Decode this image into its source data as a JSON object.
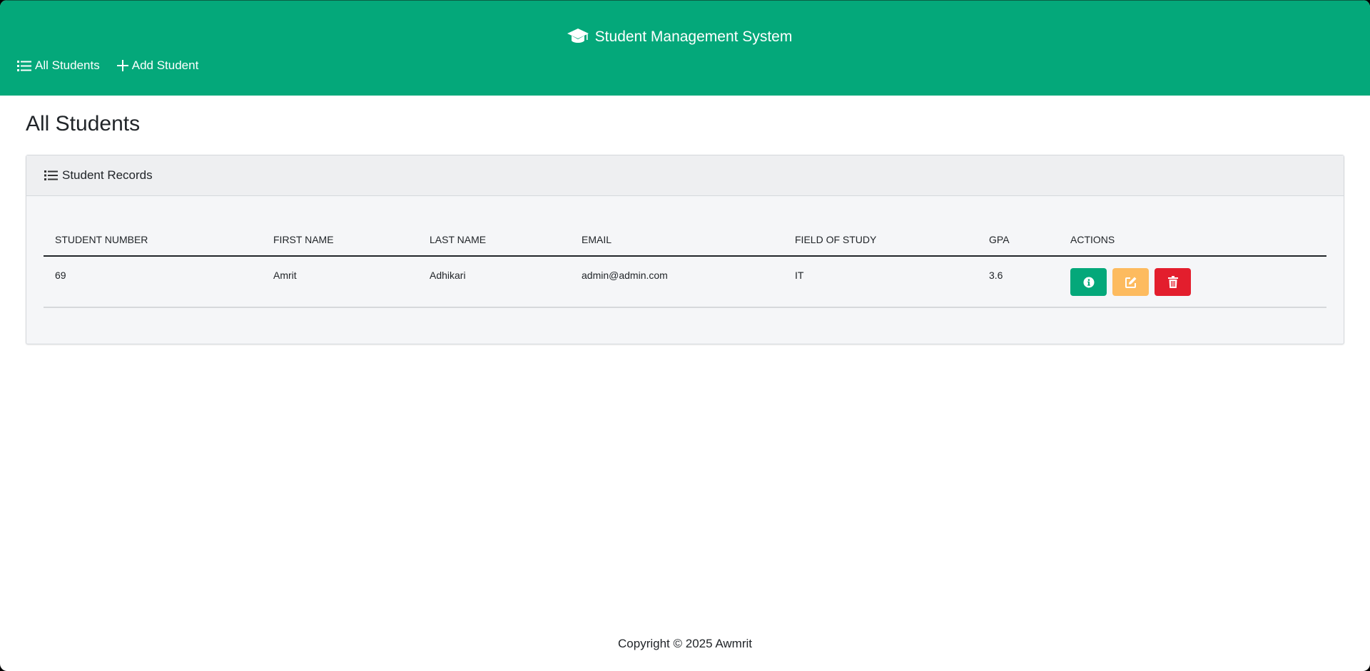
{
  "header": {
    "title": "Student Management System",
    "logo_icon": "graduation-cap-icon",
    "background": "#04a87a"
  },
  "nav": {
    "items": [
      {
        "label": "All Students",
        "icon": "list-icon"
      },
      {
        "label": "Add Student",
        "icon": "plus-icon"
      }
    ]
  },
  "main": {
    "title": "All Students",
    "card": {
      "title": "Student Records",
      "icon": "list-icon"
    },
    "table": {
      "columns": [
        "STUDENT NUMBER",
        "FIRST NAME",
        "LAST NAME",
        "EMAIL",
        "FIELD OF STUDY",
        "GPA",
        "ACTIONS"
      ],
      "rows": [
        {
          "student_number": "69",
          "first_name": "Amrit",
          "last_name": "Adhikari",
          "email": "admin@admin.com",
          "field_of_study": "IT",
          "gpa": "3.6",
          "actions": [
            {
              "icon": "info-icon",
              "color": "#04a87a"
            },
            {
              "icon": "edit-icon",
              "color": "#fdbb5f"
            },
            {
              "icon": "trash-icon",
              "color": "#e31e2d"
            }
          ]
        }
      ]
    }
  },
  "footer": {
    "text": "Copyright © 2025 Awmrit"
  }
}
